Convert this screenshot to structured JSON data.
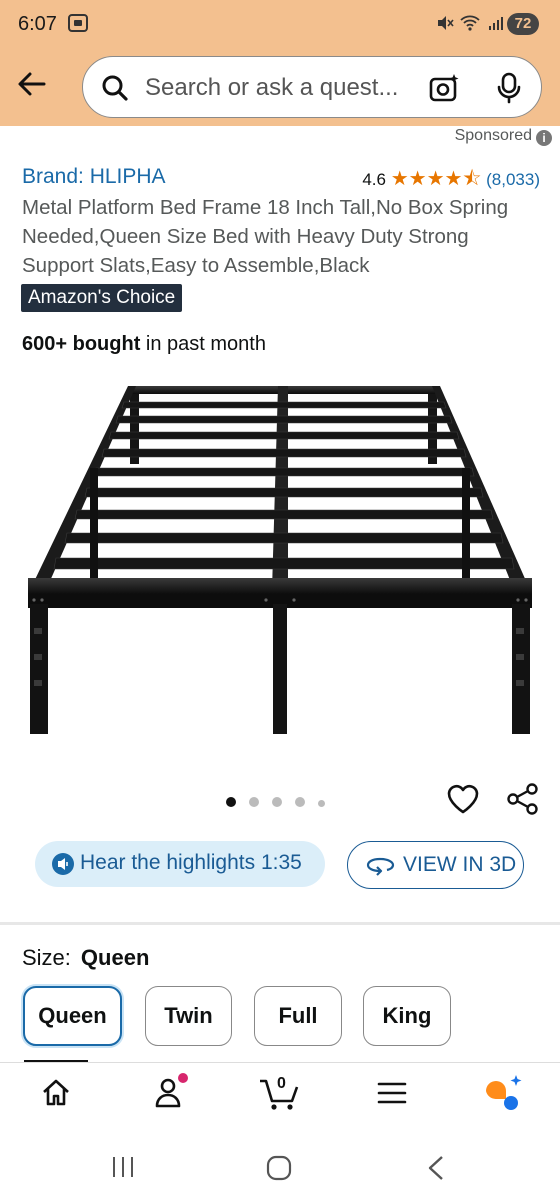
{
  "status_bar": {
    "time": "6:07",
    "battery": "72"
  },
  "search": {
    "placeholder": "Search or ask a quest..."
  },
  "sponsored": {
    "label": "Sponsored"
  },
  "product": {
    "brand": "Brand: HLIPHA",
    "rating_value": "4.6",
    "stars": "★★★★⯪",
    "star_rating": 4.6,
    "rating_count": "(8,033)",
    "title": "Metal Platform Bed Frame 18 Inch Tall,No Box Spring Needed,Queen Size Bed with Heavy Duty Strong Support Slats,Easy to Assemble,Black",
    "badge": "Amazon's Choice",
    "bought_bold": "600+ bought",
    "bought_rest": " in past month",
    "image_alt": "black metal platform bed frame"
  },
  "gallery": {
    "dot_count": 5,
    "active_index": 0
  },
  "actions": {
    "highlights_label": "Hear the highlights 1:35",
    "view3d_label": "VIEW IN 3D"
  },
  "size": {
    "label": "Size:",
    "selected": "Queen",
    "options": [
      "Queen",
      "Twin",
      "Full",
      "King"
    ]
  },
  "bottom_nav": {
    "items": [
      "home-icon",
      "account-icon",
      "cart-icon",
      "menu-icon",
      "rufus-icon"
    ],
    "cart_count": "0",
    "accent": "#ff8c1a",
    "notification_color": "#d7266d"
  },
  "colors": {
    "header_bg": "#f3c08f",
    "link": "#1a6aa8",
    "star": "#e77600",
    "badge_bg": "#232f3e"
  }
}
